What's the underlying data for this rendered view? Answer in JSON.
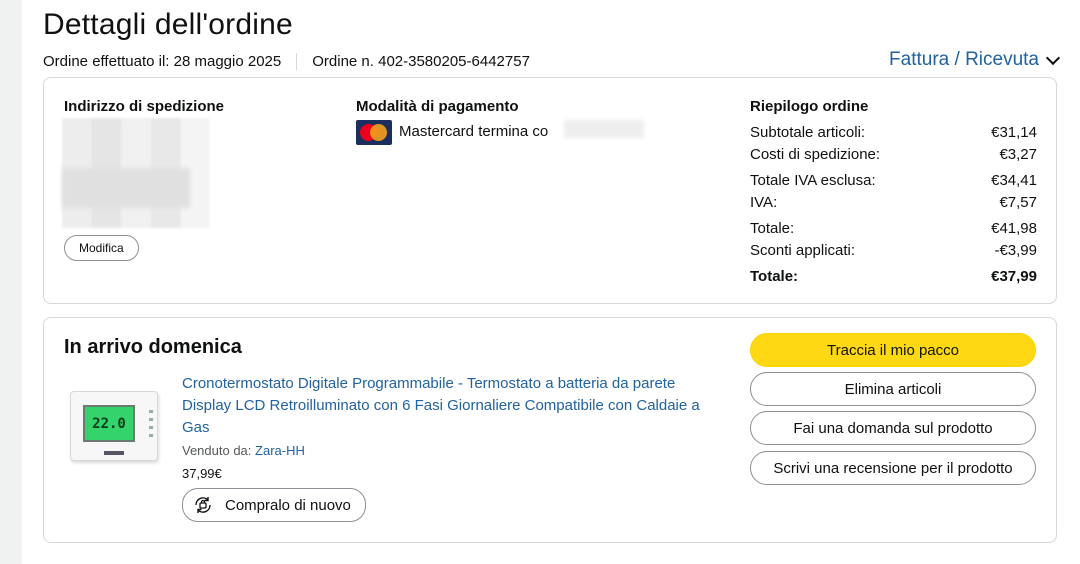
{
  "page": {
    "title": "Dettagli dell'ordine",
    "order_date": "Ordine effettuato il: 28 maggio 2025",
    "order_number": "Ordine n. 402-3580205-6442757",
    "invoice_link": "Fattura / Ricevuta"
  },
  "shipping": {
    "heading": "Indirizzo di spedizione",
    "edit_button": "Modifica"
  },
  "payment": {
    "heading": "Modalità di pagamento",
    "method": "Mastercard  termina co"
  },
  "summary": {
    "heading": "Riepilogo ordine",
    "rows": [
      {
        "label": "Subtotale articoli:",
        "value": "€31,14"
      },
      {
        "label": "Costi di spedizione:",
        "value": "€3,27"
      },
      {
        "label": "Totale IVA esclusa:",
        "value": "€34,41"
      },
      {
        "label": "IVA:",
        "value": "€7,57"
      },
      {
        "label": "Totale:",
        "value": "€41,98"
      },
      {
        "label": "Sconti applicati:",
        "value": "-€3,99"
      },
      {
        "label": "Totale:",
        "value": "€37,99"
      }
    ]
  },
  "delivery": {
    "status": "In arrivo domenica",
    "item": {
      "title": "Cronotermostato Digitale Programmabile - Termostato a batteria da parete Display LCD Retroilluminato con 6 Fasi Giornaliere Compatibile con Caldaie a Gas",
      "sold_by_label": "Venduto da:",
      "seller": "Zara-HH",
      "price": "37,99€",
      "thumb_display": "22.0",
      "buy_again": "Compralo di nuovo"
    },
    "actions": {
      "track": "Traccia il mio pacco",
      "remove": "Elimina articoli",
      "ask": "Fai una domanda sul prodotto",
      "review": "Scrivi una recensione per il prodotto"
    }
  },
  "colors": {
    "link": "#2162a1",
    "primary_button": "#ffd814",
    "text": "#0f1111"
  }
}
